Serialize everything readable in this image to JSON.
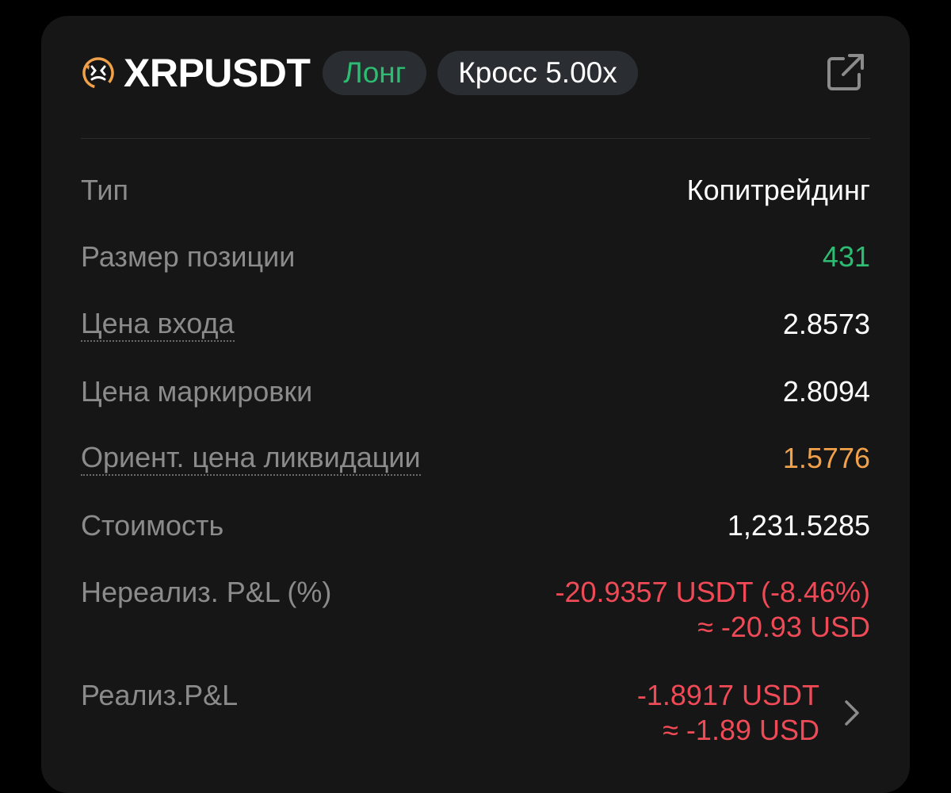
{
  "header": {
    "symbol": "XRPUSDT",
    "side_label": "Лонг",
    "margin_label": "Кросс 5.00x",
    "coin_icon": "xrp-logo-icon",
    "share_icon": "share-external-icon"
  },
  "colors": {
    "green": "#2dbd72",
    "red": "#f04a56",
    "orange": "#f0a14a",
    "card_bg": "#161616"
  },
  "rows": {
    "type": {
      "label": "Тип",
      "value": "Копитрейдинг"
    },
    "size": {
      "label": "Размер позиции",
      "value": "431"
    },
    "entry_price": {
      "label": "Цена входа",
      "value": "2.8573"
    },
    "mark_price": {
      "label": "Цена маркировки",
      "value": "2.8094"
    },
    "liq_price": {
      "label": "Ориент. цена ликвидации",
      "value": "1.5776"
    },
    "value": {
      "label": "Стоимость",
      "value": "1,231.5285"
    },
    "unrealized": {
      "label": "Нереализ. P&L (%)",
      "value_line1": "-20.9357 USDT (-8.46%)",
      "value_line2": "≈ -20.93 USD"
    },
    "realized": {
      "label": "Реализ.P&L",
      "value_line1": "-1.8917 USDT",
      "value_line2": "≈ -1.89 USD"
    }
  }
}
